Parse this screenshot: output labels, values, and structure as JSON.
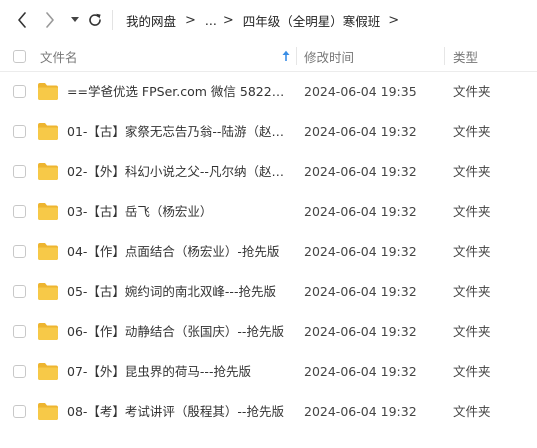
{
  "nav": {
    "back_icon": "chevron-left-icon",
    "forward_icon": "chevron-right-icon",
    "history_icon": "caret-down-icon",
    "refresh_icon": "refresh-icon"
  },
  "breadcrumb": {
    "items": [
      "我的网盘",
      "...",
      "四年级（全明星）寒假班"
    ],
    "separator": ">"
  },
  "columns": {
    "name": "文件名",
    "modified": "修改时间",
    "type": "类型"
  },
  "colors": {
    "folder": "#f7c948",
    "folder_back": "#eeb530",
    "sort_arrow": "#3a8ee6",
    "text": "#333333",
    "header_text": "#777777"
  },
  "files": [
    {
      "name": "==学爸优选 FPSer.com 微信 582229...",
      "modified": "2024-06-04 19:35",
      "type": "文件夹"
    },
    {
      "name": "01-【古】家祭无忘告乃翁--陆游（赵伯...",
      "modified": "2024-06-04 19:32",
      "type": "文件夹"
    },
    {
      "name": "02-【外】科幻小说之父--凡尔纳（赵伯...",
      "modified": "2024-06-04 19:32",
      "type": "文件夹"
    },
    {
      "name": "03-【古】岳飞（杨宏业）",
      "modified": "2024-06-04 19:32",
      "type": "文件夹"
    },
    {
      "name": "04-【作】点面结合（杨宏业）-抢先版",
      "modified": "2024-06-04 19:32",
      "type": "文件夹"
    },
    {
      "name": "05-【古】婉约词的南北双峰---抢先版",
      "modified": "2024-06-04 19:32",
      "type": "文件夹"
    },
    {
      "name": "06-【作】动静结合（张国庆）--抢先版",
      "modified": "2024-06-04 19:32",
      "type": "文件夹"
    },
    {
      "name": "07-【外】昆虫界的荷马---抢先版",
      "modified": "2024-06-04 19:32",
      "type": "文件夹"
    },
    {
      "name": "08-【考】考试讲评（殷程其）--抢先版",
      "modified": "2024-06-04 19:32",
      "type": "文件夹"
    }
  ]
}
